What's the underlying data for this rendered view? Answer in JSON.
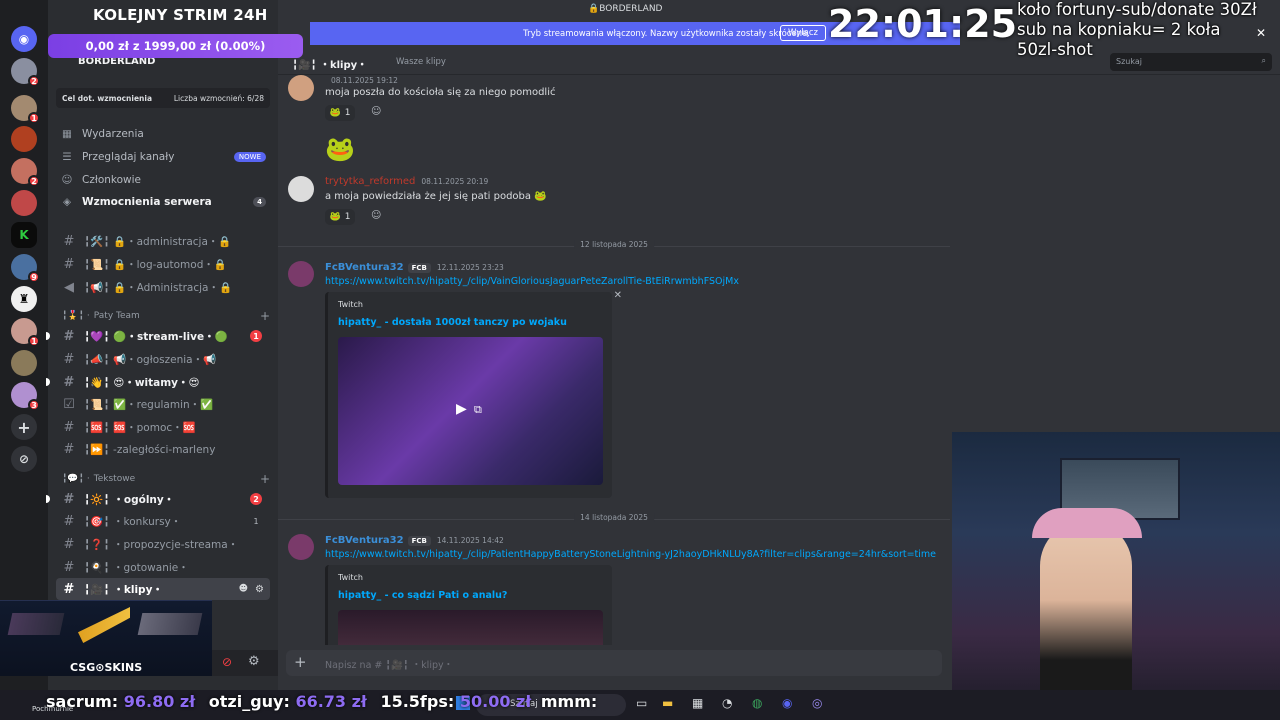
{
  "stream": {
    "title": "KOLEJNY STRIM 24H",
    "goal": "0,00 zł z 1999,00 zł (0.00%)",
    "clock": "22:01:25",
    "wheel": [
      "koło fortuny-sub/donate 30Zł",
      "sub na kopniaku= 2 koła",
      "50zl-shot"
    ],
    "ticker": [
      {
        "name": "sacrum:",
        "amount": "96.80 zł"
      },
      {
        "name": "otzi_guy:",
        "amount": "66.73 zł"
      },
      {
        "name": "15.5fps:",
        "amount": "50.00 zł"
      },
      {
        "name": "mmm:",
        "amount": ""
      }
    ],
    "csgo_logo": "CSG⊙SKINS"
  },
  "window": {
    "title": "BORDERLAND"
  },
  "banner": {
    "text": "Tryb streamowania włączony. Nazwy użytkownika zostały skrócone.",
    "button": "Wyłącz"
  },
  "server": {
    "name": "BORDERLAND",
    "boost_goal": "Cel dot. wzmocnienia",
    "boost_count": "Liczba wzmocnień: 6/28",
    "menu": [
      {
        "label": "Wydarzenia",
        "icon": "calendar-icon"
      },
      {
        "label": "Przeglądaj kanały",
        "icon": "browse-icon",
        "badge": "NOWE"
      },
      {
        "label": "Członkowie",
        "icon": "members-icon"
      },
      {
        "label": "Wzmocnienia serwera",
        "icon": "boost-icon",
        "badge": "4"
      }
    ],
    "channels_top": [
      {
        "name": "╏🛠️╏ 🔒・administracja・🔒",
        "icon": "hash"
      },
      {
        "name": "╏📜╏ 🔒・log-automod・🔒",
        "icon": "hash"
      },
      {
        "name": "╏📢╏ 🔒・Administracja・🔒",
        "icon": "speaker"
      }
    ],
    "category1": "Paty Team",
    "channels_paty": [
      {
        "name": "╏💜╏ 🟢・stream-live・🟢",
        "unread": true,
        "count": "1"
      },
      {
        "name": "╏📣╏ 📢・ogłoszenia・📢"
      },
      {
        "name": "╏👋╏ 😍・witamy・😍",
        "unread": true
      },
      {
        "name": "╏📜╏ ✅・regulamin・✅"
      },
      {
        "name": "╏🆘╏ 🆘・pomoc・🆘"
      },
      {
        "name": "╏⏩╏ -zaległości-marleny"
      }
    ],
    "category2": "Tekstowe",
    "channels_text": [
      {
        "name": "╏🔆╏ ・ogólny・",
        "unread": true,
        "count": "2"
      },
      {
        "name": "╏🎯╏ ・konkursy・",
        "count_plain": "1"
      },
      {
        "name": "╏❓╏ ・propozycje-streama・"
      },
      {
        "name": "╏🍳╏ ・gotowanie・"
      },
      {
        "name": "╏🎥╏ ・klipy・",
        "selected": true
      }
    ]
  },
  "topbar": {
    "channel": "╏🎥╏ ・klipy・",
    "thread": "Wasze klipy",
    "search_placeholder": "Szukaj"
  },
  "messages": [
    {
      "author": "",
      "timestamp": "08.11.2025 19:12",
      "text": "moja poszła do kościoła się za niego pomodlić",
      "reaction_count": "1"
    },
    {
      "author": "trytytka_reformed",
      "timestamp": "08.11.2025 20:19",
      "text": "a moja powiedziała że jej się pati podoba 🐸",
      "reaction_count": "1"
    }
  ],
  "date_separators": [
    "12 listopada 2025",
    "14 listopada 2025"
  ],
  "clips": [
    {
      "author": "FcBVentura32",
      "tag": "FCB",
      "timestamp": "12.11.2025 23:23",
      "url": "https://www.twitch.tv/hipatty_/clip/VainGloriousJaguarPeteZarollTie-BtEiRrwmbhFSOjMx",
      "provider": "Twitch",
      "title": "hipatty_ - dostała 1000zł tanczy po wojaku"
    },
    {
      "author": "FcBVentura32",
      "tag": "FCB",
      "timestamp": "14.11.2025 14:42",
      "url": "https://www.twitch.tv/hipatty_/clip/PatientHappyBatteryStoneLightning-yJ2haoyDHkNLUy8A?filter=clips&range=24hr&sort=time",
      "provider": "Twitch",
      "title": "hipatty_ - co sądzi Pati o analu?"
    }
  ],
  "composer": {
    "placeholder": "Napisz na # ╏🎥╏ ・klipy・"
  },
  "taskbar": {
    "search": "Szukaj",
    "weather": "Pochmurnie"
  },
  "colors": {
    "accent": "#5865f2",
    "link": "#00a8fc",
    "goal": "#8e5cf0",
    "mention": "#f23f43"
  }
}
